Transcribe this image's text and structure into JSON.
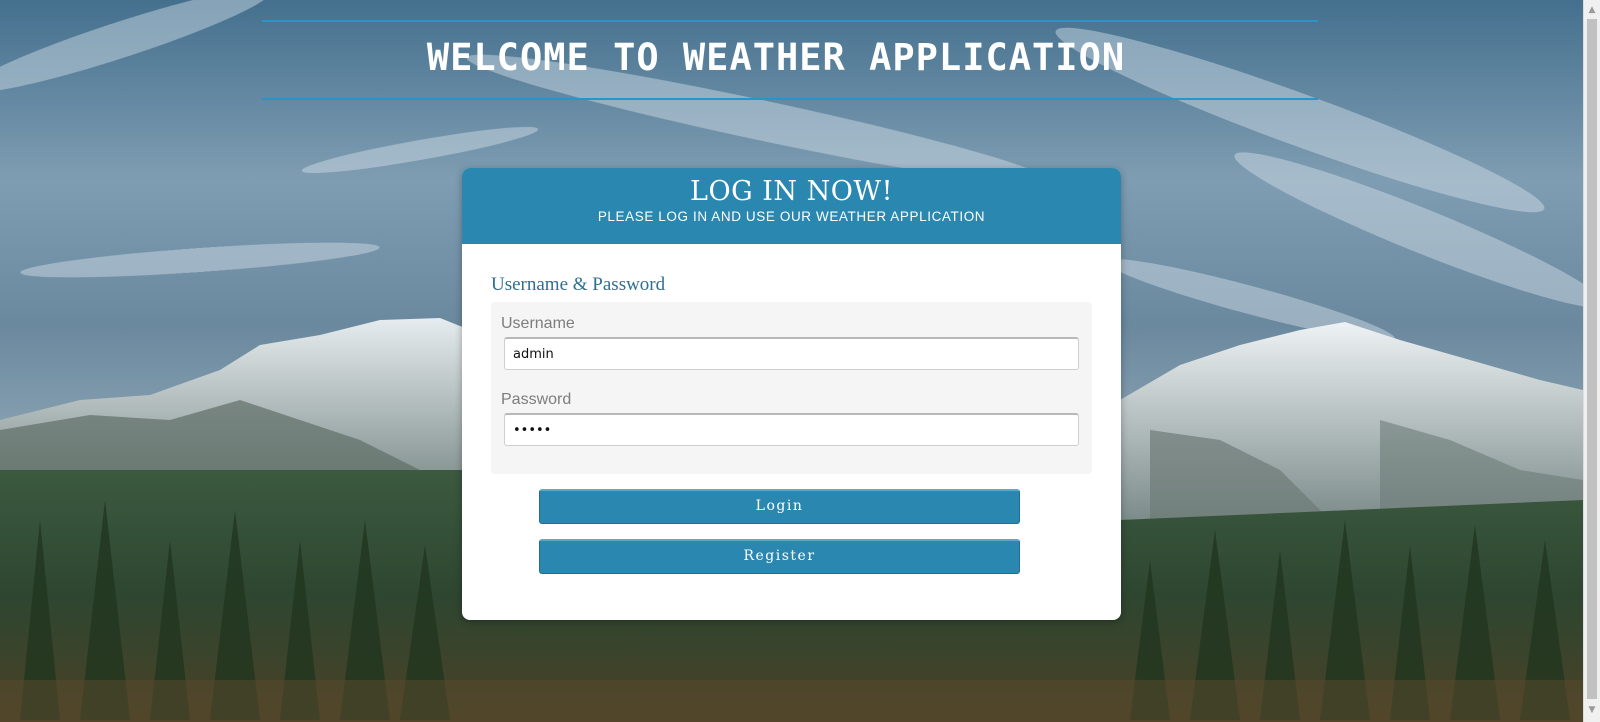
{
  "header": {
    "title": "WELCOME TO WEATHER APPLICATION"
  },
  "login_card": {
    "title": "LOG IN NOW!",
    "subtitle": "PLEASE LOG IN AND USE OUR WEATHER APPLICATION",
    "section_label": "Username & Password",
    "username": {
      "label": "Username",
      "value": "admin"
    },
    "password": {
      "label": "Password",
      "value": "admin"
    },
    "login_button": "Login",
    "register_button": "Register"
  },
  "colors": {
    "accent": "#2a88b0",
    "header_rule": "#2a95c4",
    "section_label": "#2f6f8f"
  },
  "icons": {
    "scroll_up": "chevron-up-icon",
    "scroll_down": "chevron-down-icon"
  }
}
